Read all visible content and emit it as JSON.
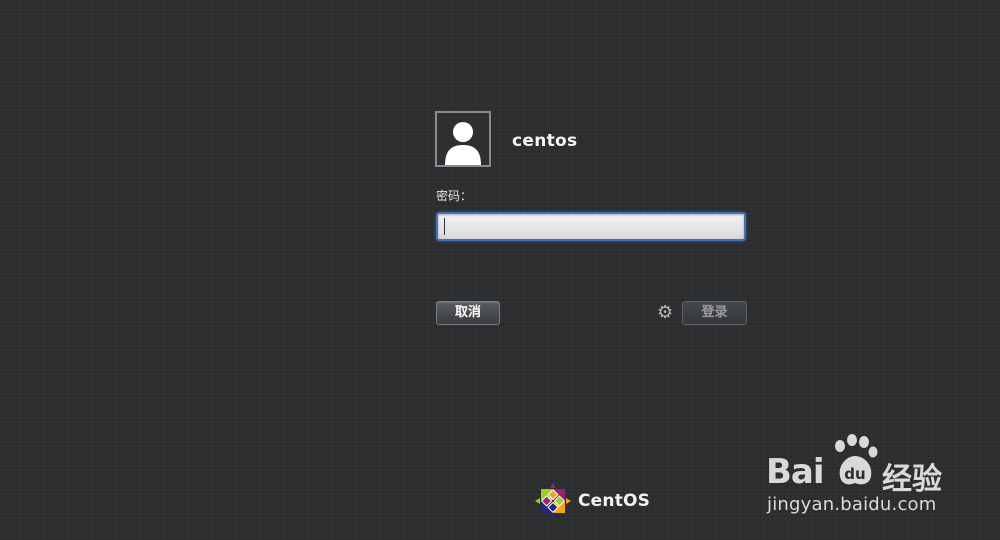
{
  "login": {
    "username": "centos",
    "password_label": "密码：",
    "password_value": "",
    "cancel_label": "取消",
    "login_label": "登录"
  },
  "icons": {
    "avatar": "user-silhouette-icon",
    "session_settings": "gear-icon",
    "brand_logo": "centos-logo-icon"
  },
  "branding": {
    "name": "CentOS"
  },
  "watermark": {
    "logo_left": "Bai",
    "logo_right": "经验",
    "url": "jingyan.baidu.com"
  },
  "colors": {
    "background": "#2c2e30",
    "input_focus_border": "#3f72b8",
    "centos_purple": "#932279",
    "centos_yellow": "#efa724",
    "centos_green": "#9ccd2a",
    "centos_blue": "#262577"
  }
}
